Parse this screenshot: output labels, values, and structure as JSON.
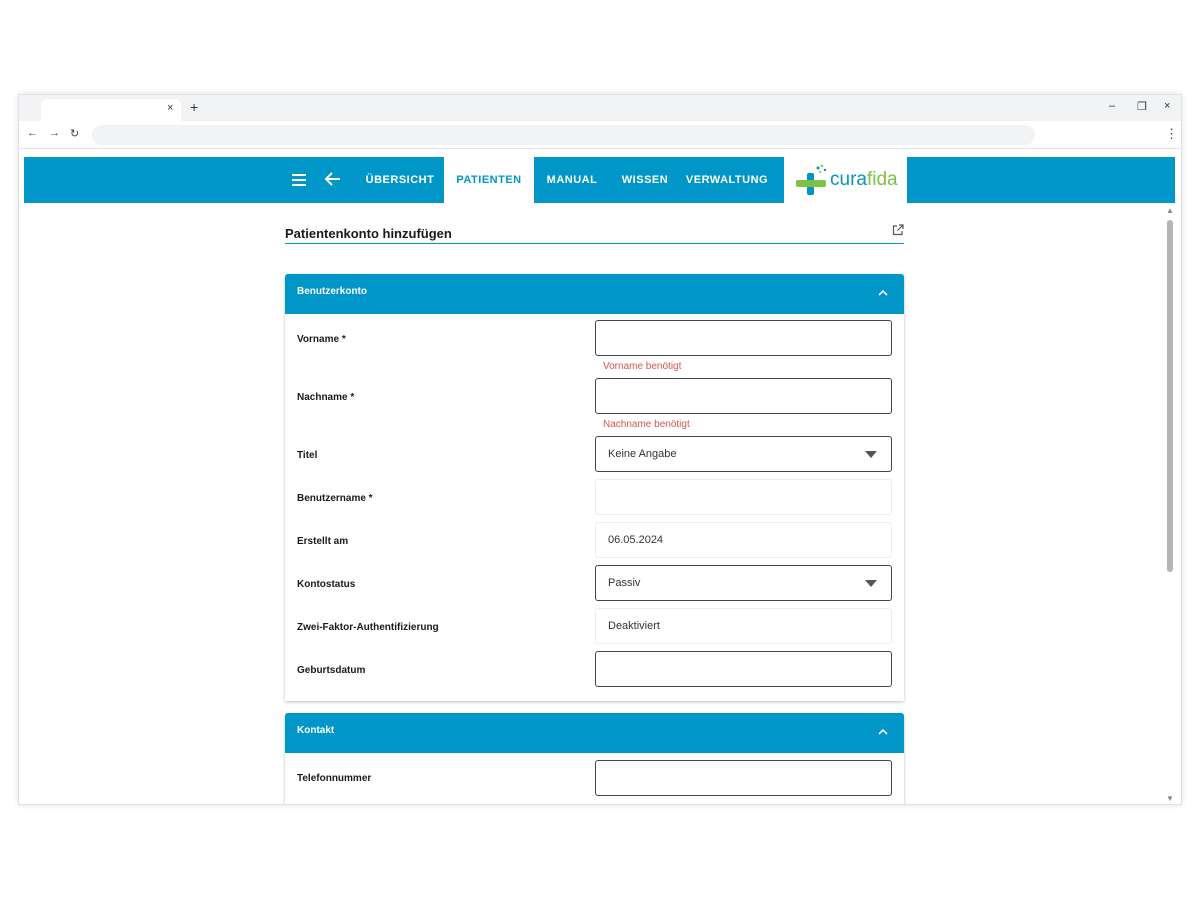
{
  "browser": {
    "tab_close": "×",
    "new_tab": "+",
    "minimize": "–",
    "restore": "❐",
    "close": "×",
    "back": "←",
    "forward": "→",
    "reload": "↻",
    "menu": "⋮",
    "url": ""
  },
  "app": {
    "nav": {
      "items": [
        "ÜBERSICHT",
        "PATIENTEN",
        "MANUAL",
        "WISSEN",
        "VERWALTUNG"
      ],
      "active": "PATIENTEN"
    },
    "logo": {
      "part1": "cura",
      "part2": "fida"
    },
    "colors": {
      "primary": "#0096c8",
      "logo_green": "#7dc242",
      "error": "#d9534f"
    },
    "icons": [
      "menu-icon",
      "arrow-left-icon",
      "external-link-icon",
      "chevron-up-icon",
      "caret-down-icon"
    ]
  },
  "page": {
    "title": "Patientenkonto hinzufügen"
  },
  "account_panel": {
    "title": "Benutzerkonto",
    "firstname_label": "Vorname *",
    "firstname_value": "",
    "firstname_error": "Vorname benötigt",
    "lastname_label": "Nachname *",
    "lastname_value": "",
    "lastname_error": "Nachname benötigt",
    "title_label": "Titel",
    "title_value": "Keine Angabe",
    "username_label": "Benutzername *",
    "username_value": "",
    "created_label": "Erstellt am",
    "created_value": "06.05.2024",
    "status_label": "Kontostatus",
    "status_value": "Passiv",
    "twofa_label": "Zwei-Faktor-Authentifizierung",
    "twofa_value": "Deaktiviert",
    "birthdate_label": "Geburtsdatum",
    "birthdate_value": ""
  },
  "contact_panel": {
    "title": "Kontakt",
    "phone_label": "Telefonnummer",
    "phone_value": ""
  }
}
